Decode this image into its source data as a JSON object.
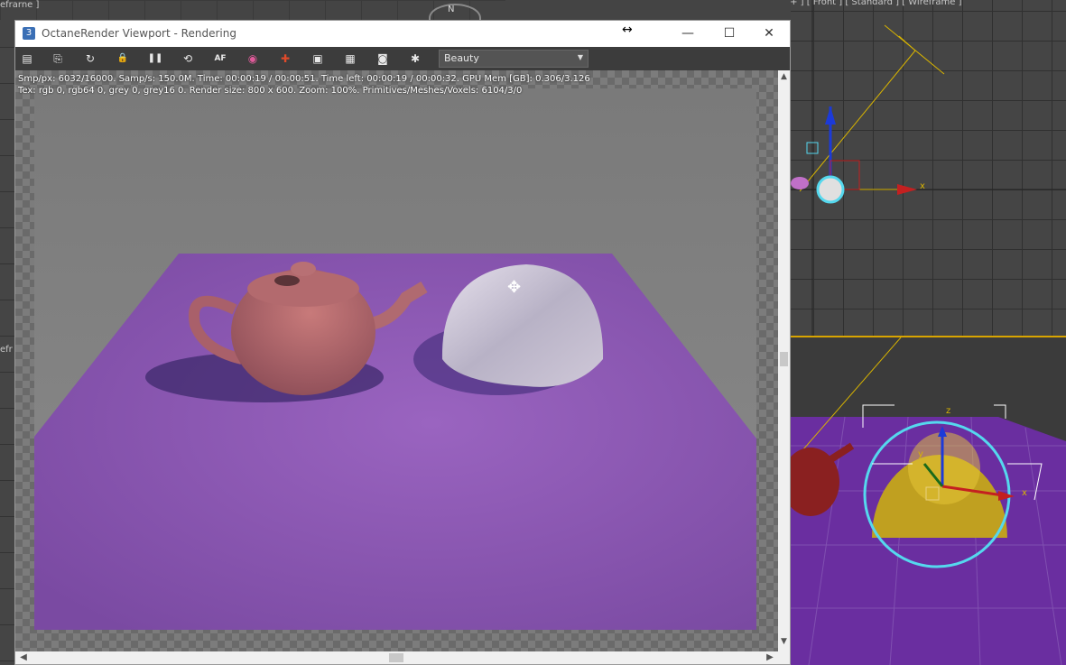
{
  "background": {
    "top_left_label": "efrarne ]",
    "front_label": "[ + ] [ Front ] [ Standard ] [ Wireframe ]",
    "left_edge_label": "efr",
    "compass_label": "N",
    "axis_x": "x",
    "axis_y": "y",
    "axis_z": "z"
  },
  "window": {
    "title": "OctaneRender Viewport - Rendering",
    "app_icon": "3",
    "minimize_icon": "—",
    "maximize_icon": "☐",
    "close_icon": "✕",
    "resize_cursor": "↔"
  },
  "toolbar": {
    "buttons": [
      {
        "name": "save-render-icon",
        "glyph": "▤"
      },
      {
        "name": "copy-icon",
        "glyph": "⎘"
      },
      {
        "name": "restart-render-icon",
        "glyph": "↻"
      },
      {
        "name": "lock-icon",
        "glyph": "🔒"
      },
      {
        "name": "pause-icon",
        "glyph": "❚❚"
      },
      {
        "name": "refresh-icon",
        "glyph": "⟲"
      },
      {
        "name": "autofocus-icon",
        "glyph": "AF"
      },
      {
        "name": "color-picker-icon",
        "glyph": "◉"
      },
      {
        "name": "region-render-icon",
        "glyph": "✚"
      },
      {
        "name": "display-icon",
        "glyph": "▣"
      },
      {
        "name": "film-icon",
        "glyph": "▦"
      },
      {
        "name": "camera-icon",
        "glyph": "◙"
      },
      {
        "name": "settings-gear-icon",
        "glyph": "✱"
      }
    ],
    "pass_dropdown_value": "Beauty",
    "dropdown_arrow": "▼"
  },
  "stats": {
    "line1": "Smp/px: 6032/16000.   Samp/s: 150.0M.   Time: 00:00:19 / 00:00:51.   Time left: 00:00:19 / 00:00:32.   GPU Mem [GB]: 0.306/3.126",
    "line2": "Tex: rgb 0, rgb64 0, grey 0, grey16 0.   Render size: 800 x 600.   Zoom: 100%.   Primitives/Meshes/Voxels: 6104/3/0"
  },
  "scroll": {
    "up": "▲",
    "down": "▼",
    "left": "◀",
    "right": "▶"
  },
  "colors": {
    "toolbar": "#3c3c3c",
    "floor": "#8a55b0",
    "teapot": "#b86868",
    "selection": "#55d8ee",
    "yellow_line": "#d8b400"
  }
}
